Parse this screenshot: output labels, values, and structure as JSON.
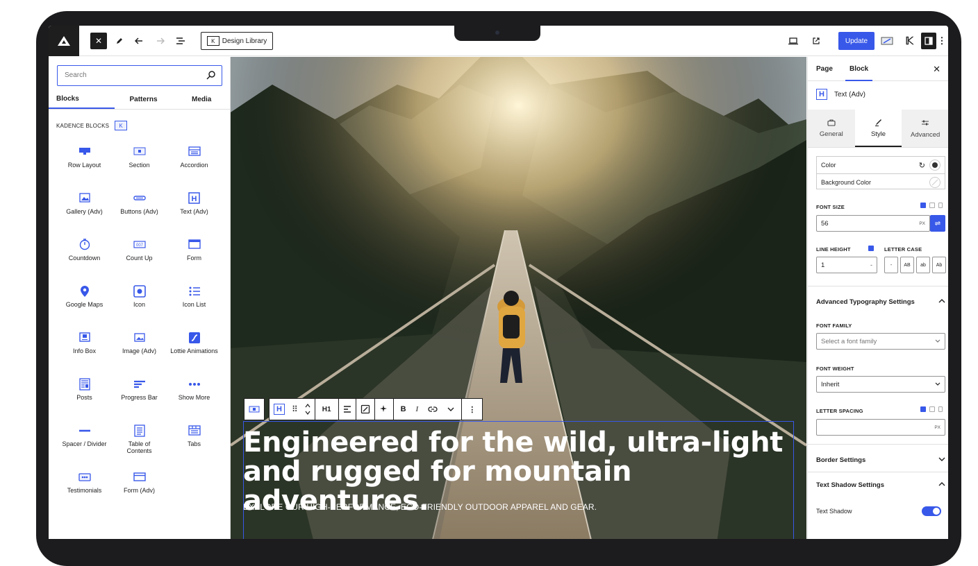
{
  "topbar": {
    "design_library_label": "Design Library",
    "update_label": "Update"
  },
  "inserter": {
    "search_placeholder": "Search",
    "tabs": [
      "Blocks",
      "Patterns",
      "Media"
    ],
    "category_label": "KADENCE BLOCKS",
    "blocks": [
      {
        "label": "Row Layout",
        "icon": "row-layout-icon"
      },
      {
        "label": "Section",
        "icon": "section-icon"
      },
      {
        "label": "Accordion",
        "icon": "accordion-icon"
      },
      {
        "label": "Gallery (Adv)",
        "icon": "gallery-icon"
      },
      {
        "label": "Buttons (Adv)",
        "icon": "buttons-icon"
      },
      {
        "label": "Text (Adv)",
        "icon": "text-adv-icon"
      },
      {
        "label": "Countdown",
        "icon": "countdown-icon"
      },
      {
        "label": "Count Up",
        "icon": "count-up-icon"
      },
      {
        "label": "Form",
        "icon": "form-icon"
      },
      {
        "label": "Google Maps",
        "icon": "map-pin-icon"
      },
      {
        "label": "Icon",
        "icon": "icon-block-icon"
      },
      {
        "label": "Icon List",
        "icon": "icon-list-icon"
      },
      {
        "label": "Info Box",
        "icon": "info-box-icon"
      },
      {
        "label": "Image (Adv)",
        "icon": "image-icon"
      },
      {
        "label": "Lottie Animations",
        "icon": "lottie-icon"
      },
      {
        "label": "Posts",
        "icon": "posts-icon"
      },
      {
        "label": "Progress Bar",
        "icon": "progress-bar-icon"
      },
      {
        "label": "Show More",
        "icon": "show-more-icon"
      },
      {
        "label": "Spacer / Divider",
        "icon": "spacer-icon"
      },
      {
        "label": "Table of Contents",
        "icon": "table-of-contents-icon"
      },
      {
        "label": "Tabs",
        "icon": "tabs-icon"
      },
      {
        "label": "Testimonials",
        "icon": "testimonials-icon"
      },
      {
        "label": "Form (Adv)",
        "icon": "form-adv-icon"
      }
    ]
  },
  "canvas": {
    "heading_level": "H1",
    "heading": "Engineered for the wild, ultra-light and rugged for mountain adventures.",
    "subheading": "EXPLORE OUR HIGH-PERFORMANCE, ECO-FRIENDLY OUTDOOR APPAREL AND GEAR.",
    "toolbar_bold": "B",
    "toolbar_italic": "I"
  },
  "settings": {
    "tabs": [
      "Page",
      "Block"
    ],
    "block_name": "Text (Adv)",
    "style_tabs": [
      "General",
      "Style",
      "Advanced"
    ],
    "color_label": "Color",
    "background_color_label": "Background Color",
    "font_size_label": "FONT SIZE",
    "font_size_value": "56",
    "font_size_unit": "PX",
    "line_height_label": "LINE HEIGHT",
    "letter_case_label": "LETTER CASE",
    "line_height_value": "1",
    "letter_case_options": [
      "-",
      "AB",
      "ab",
      "Ab"
    ],
    "advanced_typography_label": "Advanced Typography Settings",
    "font_family_label": "FONT FAMILY",
    "font_family_placeholder": "Select a font family",
    "font_weight_label": "FONT WEIGHT",
    "font_weight_value": "Inherit",
    "letter_spacing_label": "LETTER SPACING",
    "letter_spacing_unit": "PX",
    "border_settings_label": "Border Settings",
    "text_shadow_settings_label": "Text Shadow Settings",
    "text_shadow_label": "Text Shadow",
    "text_shadow_enabled": true
  },
  "colors": {
    "accent": "#3858e9",
    "dark": "#1e1e1e"
  }
}
